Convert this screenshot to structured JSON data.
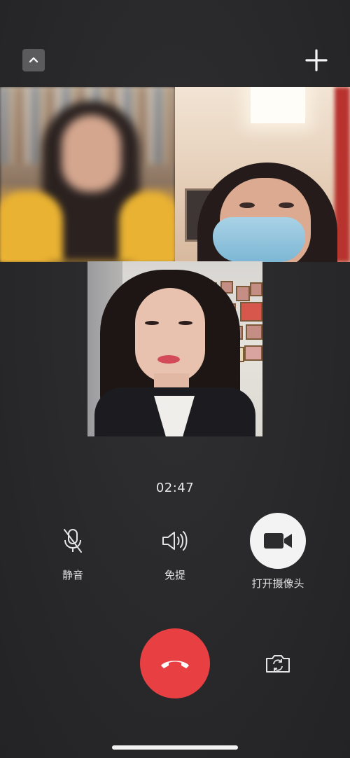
{
  "call": {
    "timer": "02:47"
  },
  "controls": {
    "mute_label": "静音",
    "speaker_label": "免提",
    "camera_label": "打开摄像头"
  },
  "icons": {
    "minimize": "chevron-up-icon",
    "add": "plus-icon",
    "mute": "microphone-off-icon",
    "speaker": "speaker-icon",
    "camera": "video-camera-icon",
    "hangup": "phone-hangup-icon",
    "flip": "camera-flip-icon"
  },
  "colors": {
    "background": "#2a2a2c",
    "hangup": "#e84042",
    "camera_button": "#f3f3f3"
  }
}
